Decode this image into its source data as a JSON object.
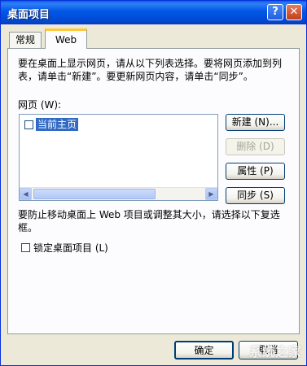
{
  "window": {
    "title": "桌面项目"
  },
  "tabs": [
    {
      "label": "常规"
    },
    {
      "label": "Web"
    }
  ],
  "web": {
    "description": "要在桌面上显示网页，请从以下列表选择。要将网页添加到列表，请单击“新建”。要更新网页内容，请单击“同步”。",
    "webpages_label": "网页 (W):",
    "list_items": [
      {
        "label": "当前主页",
        "checked": false
      }
    ],
    "buttons": {
      "new": "新建 (N)...",
      "delete": "删除 (D)",
      "properties": "属性 (P)",
      "sync": "同步 (S)"
    },
    "note": "要防止移动桌面上 Web 项目或调整其大小，请选择以下复选框。",
    "lock_label": "锁定桌面项目 (L)"
  },
  "footer": {
    "ok": "确定",
    "cancel": "取消"
  },
  "watermark": "系统之家"
}
